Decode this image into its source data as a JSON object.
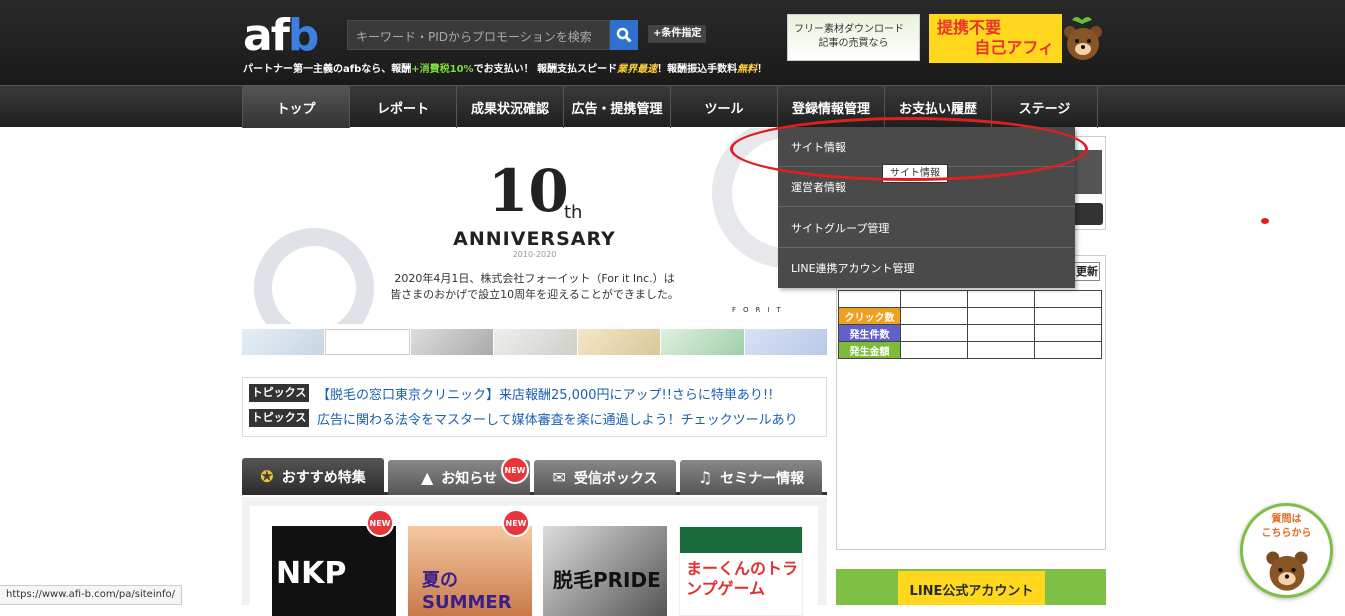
{
  "header": {
    "logo": {
      "part1": "af",
      "part2": "b"
    },
    "tagline": {
      "part1": "パートナー第一主義のafbなら、報酬",
      "part2": "+消費税10%",
      "part3": "でお支払い！ 報酬支払スピード",
      "part4": "業界最速",
      "part5": "！報酬振込手数料",
      "part6": "無料",
      "part7": "！"
    },
    "search_placeholder": "キーワード・PIDからプロモーションを検索",
    "condition_button": "+条件指定",
    "banner1": {
      "line1": "フリー素材ダウンロード",
      "line2": "記事の売買なら"
    },
    "banner2": {
      "line1": "提携不要",
      "line2": "自己アフィ"
    }
  },
  "nav": {
    "items": [
      "トップ",
      "レポート",
      "成果状況確認",
      "広告・提携管理",
      "ツール",
      "登録情報管理",
      "お支払い履歴",
      "ステージ"
    ]
  },
  "dropdown": {
    "items": [
      "サイト情報",
      "運営者情報",
      "サイトグループ管理",
      "LINE連携アカウント管理"
    ],
    "tooltip": "サイト情報"
  },
  "hero": {
    "ten": "10",
    "th": "th",
    "anniversary": "ANNIVERSARY",
    "years": "2010-2020",
    "text_line1": "2020年4月1日、株式会社フォーイット（For it Inc.）は",
    "text_line2": "皆さまのおかげで設立10周年を迎えることができました。",
    "forit": "FORIT"
  },
  "topics": [
    {
      "tag": "トピックス",
      "text": "【脱毛の窓口東京クリニック】来店報酬25,000円にアップ!!さらに特単あり!!"
    },
    {
      "tag": "トピックス",
      "text": "広告に関わる法令をマスターして媒体審査を楽に通過しよう！チェックツールあり"
    }
  ],
  "tabs": [
    {
      "label": "おすすめ特集",
      "icon": "medal-icon"
    },
    {
      "label": "お知らせ",
      "icon": "cone-icon"
    },
    {
      "label": "受信ボックス",
      "icon": "mail-icon"
    },
    {
      "label": "セミナー情報",
      "icon": "headphone-icon"
    }
  ],
  "new_badge": "NEW",
  "cards": [
    {
      "title": "NKP"
    },
    {
      "title": "夏の SUMMER"
    },
    {
      "title": "脱毛PRIDE"
    },
    {
      "title": "まーくんのトランプゲーム"
    }
  ],
  "right": {
    "refresh": "更新",
    "stats": [
      {
        "label": "クリック数",
        "color": "#f0a020"
      },
      {
        "label": "発生件数",
        "color": "#6060c8"
      },
      {
        "label": "発生金額",
        "color": "#7dbb3a"
      }
    ],
    "line_banner": "LINE公式アカウント",
    "question": {
      "line1": "質問は",
      "line2": "こちらから"
    }
  },
  "statusbar": "https://www.afi-b.com/pa/siteinfo/"
}
